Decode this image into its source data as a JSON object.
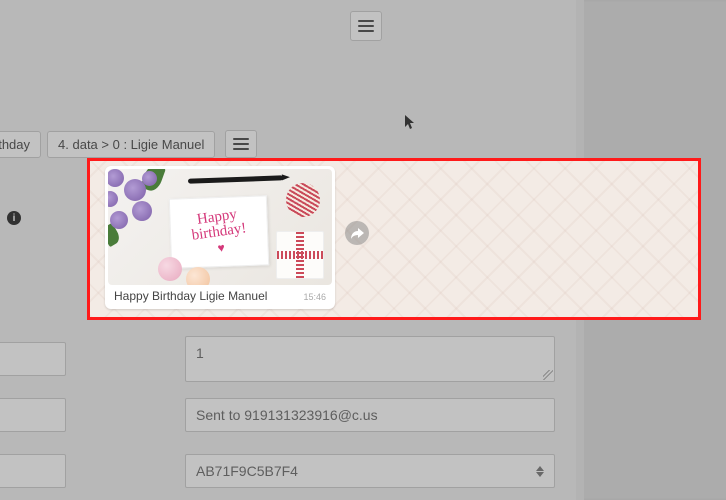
{
  "breadcrumb": {
    "partial": "irthday",
    "item4": "4. data > 0 : Ligie Manuel"
  },
  "message": {
    "caption": "Happy Birthday Ligie Manuel",
    "time": "15:46",
    "card_text": "Happy birthday!"
  },
  "fields": {
    "count": "1",
    "sent_to": "Sent to 919131323916@c.us",
    "id": "AB71F9C5B7F4"
  },
  "icons": {
    "info": "i"
  }
}
